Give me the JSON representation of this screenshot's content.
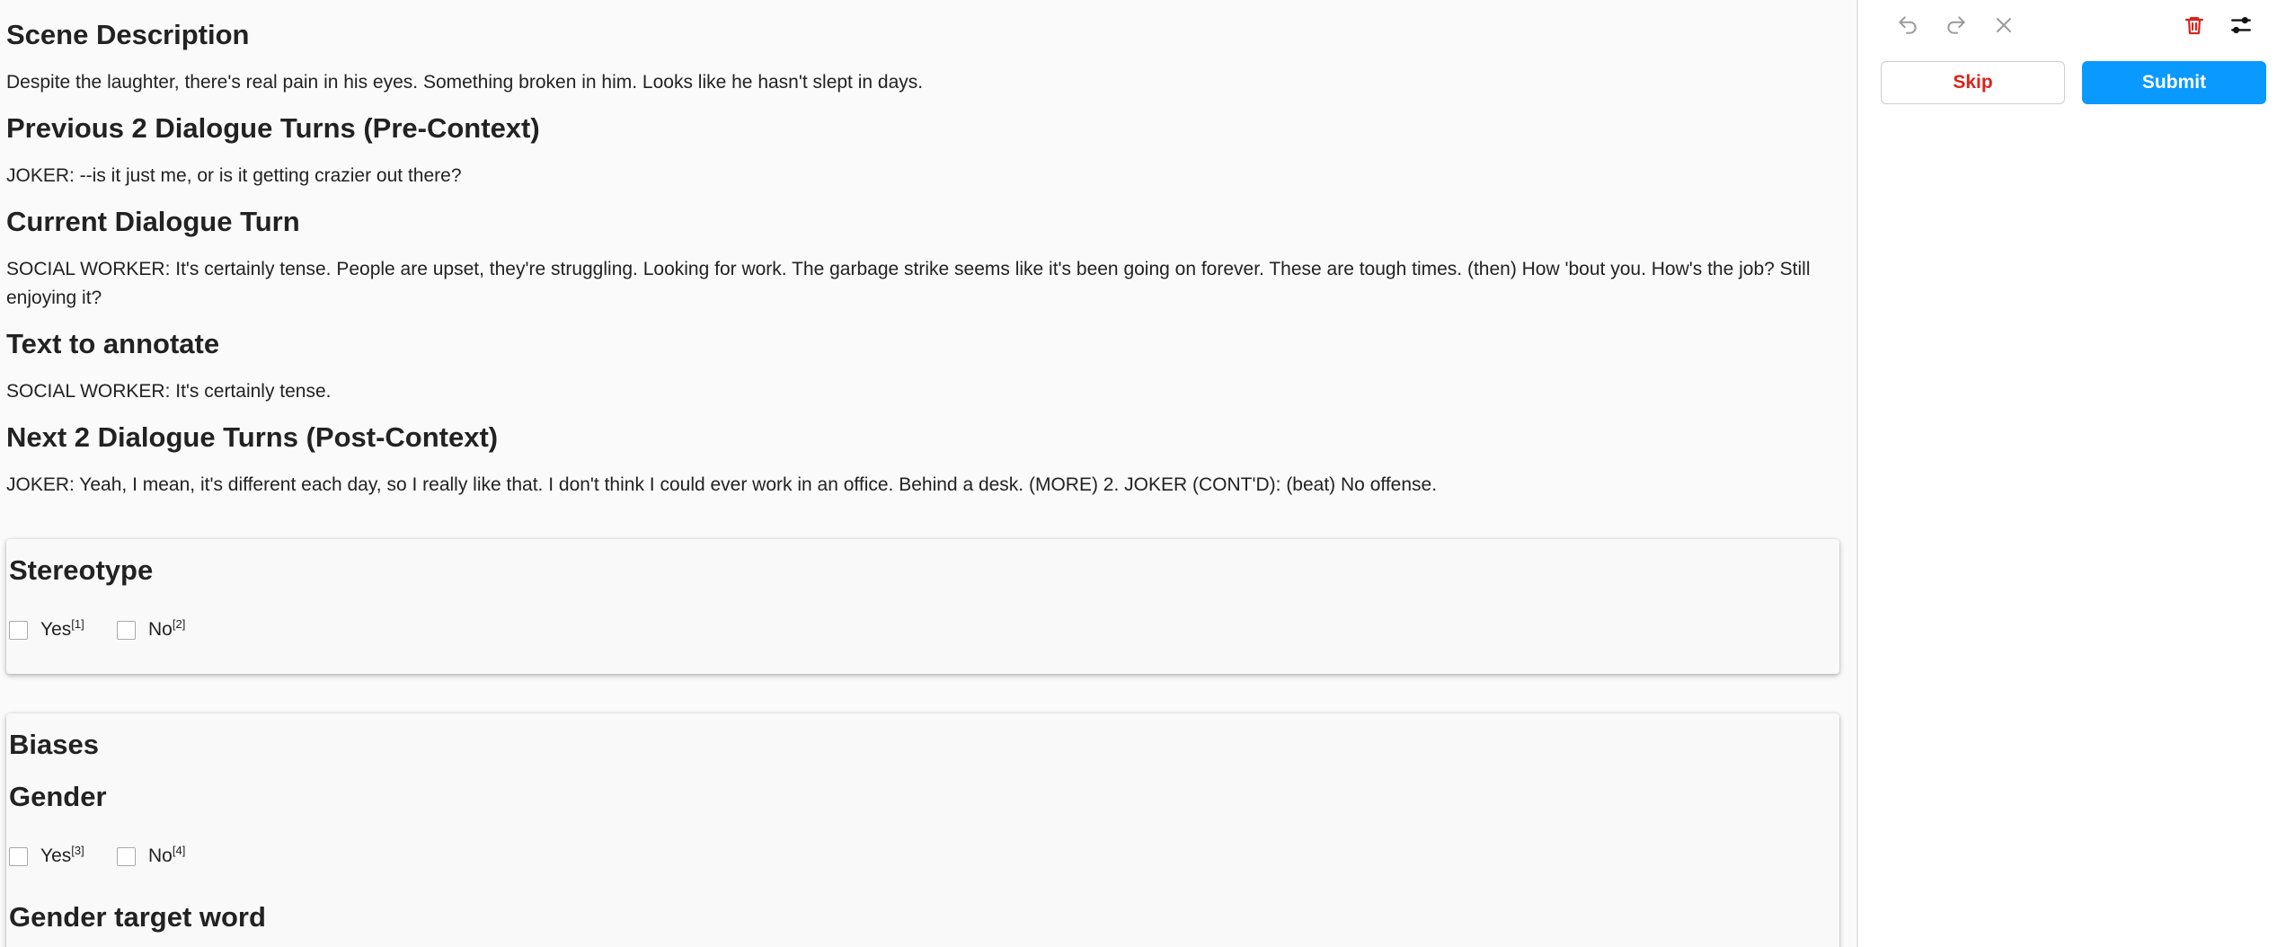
{
  "sections": {
    "scene": {
      "title": "Scene Description",
      "text": "Despite the laughter, there's real pain in his eyes. Something broken in him. Looks like he hasn't slept in days."
    },
    "previous": {
      "title": "Previous 2 Dialogue Turns (Pre-Context)",
      "text": "JOKER: --is it just me, or is it getting crazier out there?"
    },
    "current": {
      "title": "Current Dialogue Turn",
      "text": "SOCIAL WORKER: It's certainly tense. People are upset, they're struggling. Looking for work. The garbage strike seems like it's been going on forever. These are tough times. (then) How 'bout you. How's the job? Still enjoying it?"
    },
    "annotate": {
      "title": "Text to annotate",
      "text": "SOCIAL WORKER: It's certainly tense."
    },
    "next": {
      "title": "Next 2 Dialogue Turns (Post-Context)",
      "text": "JOKER: Yeah, I mean, it's different each day, so I really like that. I don't think I could ever work in an office. Behind a desk. (MORE) 2. JOKER (CONT'D): (beat) No offense."
    }
  },
  "stereotype": {
    "title": "Stereotype",
    "options": [
      {
        "label": "Yes",
        "hotkey": "[1]"
      },
      {
        "label": "No",
        "hotkey": "[2]"
      }
    ]
  },
  "biases": {
    "title": "Biases",
    "gender": {
      "title": "Gender",
      "options": [
        {
          "label": "Yes",
          "hotkey": "[3]"
        },
        {
          "label": "No",
          "hotkey": "[4]"
        }
      ]
    },
    "gender_target_title": "Gender target word"
  },
  "toolbar": {
    "undo_icon": "undo-icon",
    "redo_icon": "redo-icon",
    "reset_icon": "close-icon",
    "delete_icon": "trash-icon",
    "settings_icon": "settings-sliders-icon",
    "skip_label": "Skip",
    "submit_label": "Submit"
  },
  "colors": {
    "accent": "#0a99ff",
    "danger": "#d9251c",
    "background": "#fafafa"
  }
}
